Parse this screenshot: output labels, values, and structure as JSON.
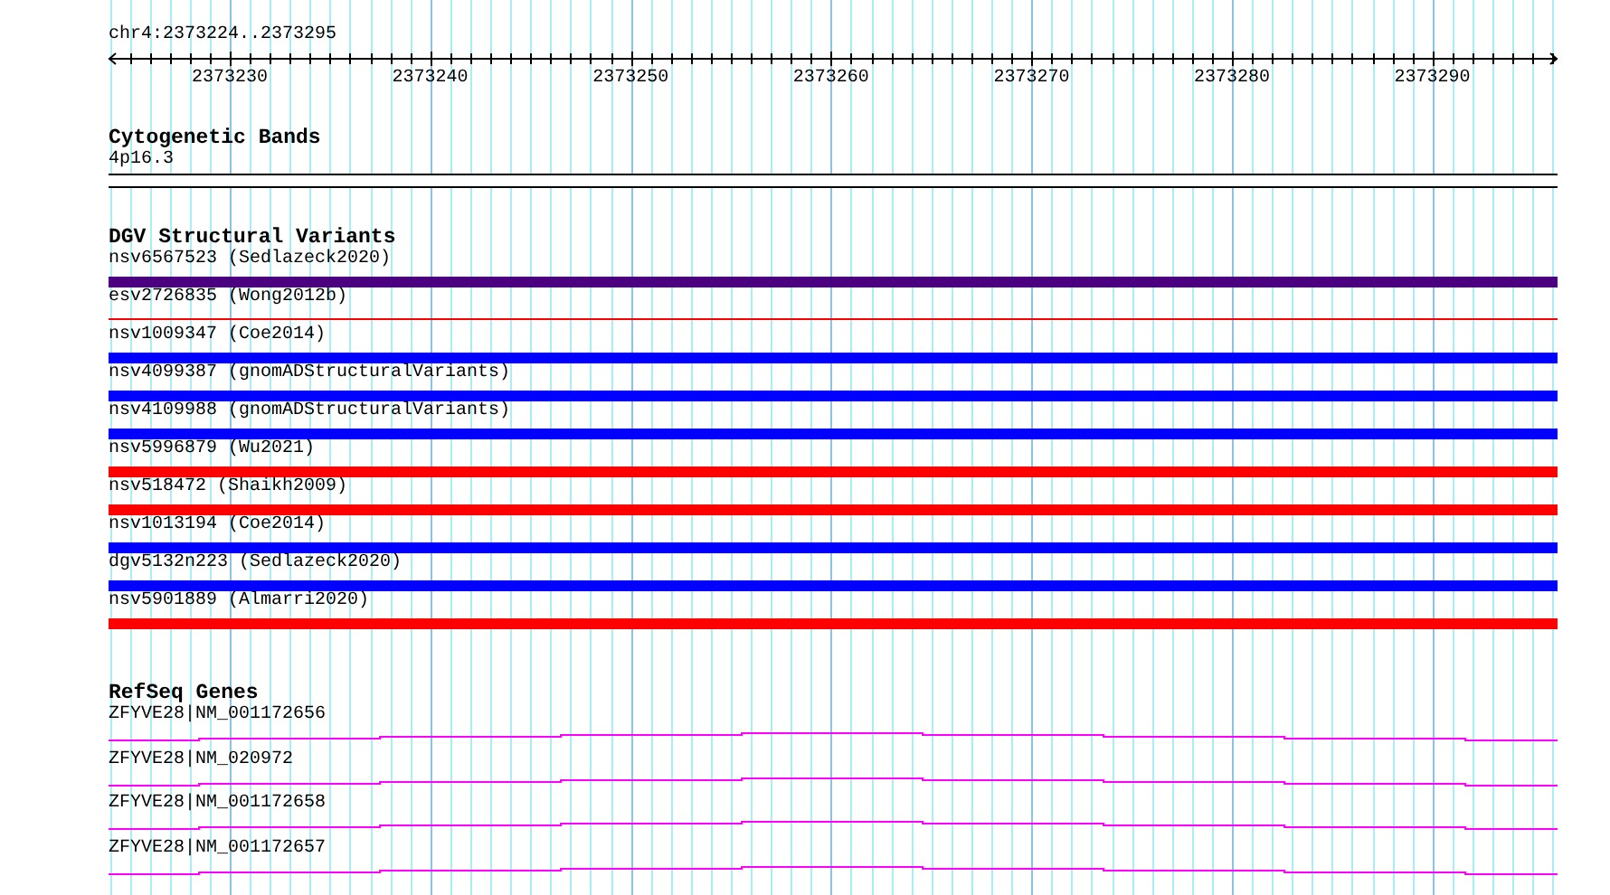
{
  "position": "chr4:2373224..2373295",
  "ruler": {
    "labels": [
      "2373230",
      "2373240",
      "2373250",
      "2373260",
      "2373270",
      "2373280",
      "2373290"
    ]
  },
  "tracks": [
    {
      "title": "Cytogenetic Bands",
      "kind": "cytoband",
      "items": [
        {
          "label": "4p16.3"
        }
      ]
    },
    {
      "title": "DGV Structural Variants",
      "kind": "variants",
      "items": [
        {
          "label": "nsv6567523 (Sedlazeck2020)",
          "color": "#4b0080",
          "kind": "bar"
        },
        {
          "label": "esv2726835 (Wong2012b)",
          "color": "#ff0000",
          "kind": "line"
        },
        {
          "label": "nsv1009347 (Coe2014)",
          "color": "#0000ff",
          "kind": "bar"
        },
        {
          "label": "nsv4099387 (gnomADStructuralVariants)",
          "color": "#0000ff",
          "kind": "bar"
        },
        {
          "label": "nsv4109988 (gnomADStructuralVariants)",
          "color": "#0000ff",
          "kind": "bar"
        },
        {
          "label": "nsv5996879 (Wu2021)",
          "color": "#ff0000",
          "kind": "bar"
        },
        {
          "label": "nsv518472 (Shaikh2009)",
          "color": "#ff0000",
          "kind": "bar"
        },
        {
          "label": "nsv1013194 (Coe2014)",
          "color": "#0000ff",
          "kind": "bar"
        },
        {
          "label": "dgv5132n223 (Sedlazeck2020)",
          "color": "#0000ff",
          "kind": "bar"
        },
        {
          "label": "nsv5901889 (Almarri2020)",
          "color": "#ff0000",
          "kind": "bar"
        }
      ]
    },
    {
      "title": "RefSeq Genes",
      "kind": "genes",
      "items": [
        {
          "label": "ZFYVE28|NM_001172656"
        },
        {
          "label": "ZFYVE28|NM_020972"
        },
        {
          "label": "ZFYVE28|NM_001172658"
        },
        {
          "label": "ZFYVE28|NM_001172657"
        }
      ]
    }
  ]
}
